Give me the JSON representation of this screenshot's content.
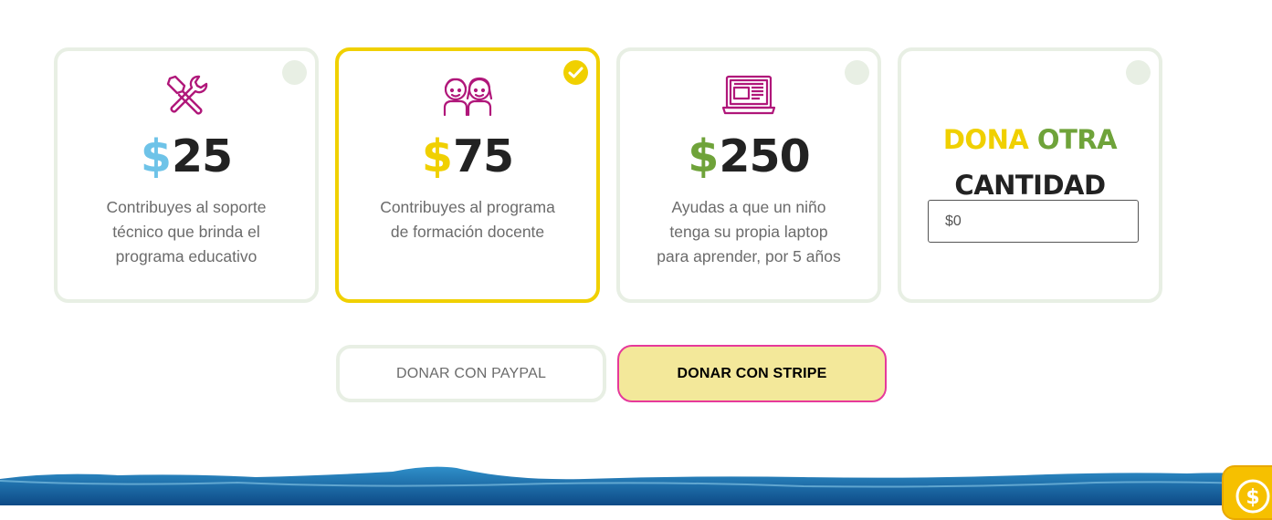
{
  "options": [
    {
      "symbol": "$",
      "amount": "25",
      "description": "Contribuyes al soporte técnico que brinda el programa educativo",
      "icon": "tools-icon",
      "symbol_color": "#6ec3e8",
      "selected": false
    },
    {
      "symbol": "$",
      "amount": "75",
      "description": "Contribuyes al programa de formación docente",
      "icon": "children-icon",
      "symbol_color": "#f0d000",
      "selected": true
    },
    {
      "symbol": "$",
      "amount": "250",
      "description": "Ayudas a que un niño tenga su propia laptop para aprender, por 5 años",
      "icon": "laptop-icon",
      "symbol_color": "#6fa33a",
      "selected": false
    }
  ],
  "other": {
    "word1": "DONA",
    "word2": "OTRA",
    "word3": "CANTIDAD",
    "word1_color": "#f0d000",
    "word2_color": "#6fa33a",
    "input_value": "$0"
  },
  "buttons": {
    "paypal": "DONAR CON PAYPAL",
    "stripe": "DONAR CON STRIPE"
  },
  "colors": {
    "icon_magenta": "#b0177a",
    "selected_border": "#f0d000",
    "stripe_bg": "#f3e89a",
    "stripe_border": "#e6399b"
  },
  "fab": {
    "icon": "dollar-coin-icon"
  }
}
